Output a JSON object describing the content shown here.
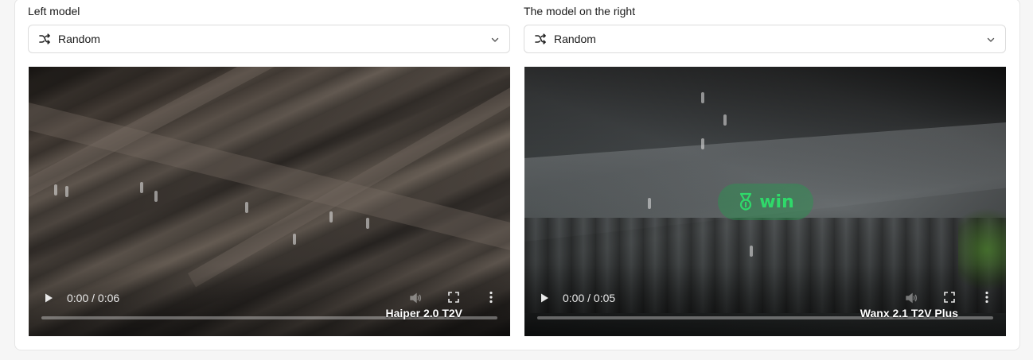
{
  "left_panel": {
    "label": "Left model",
    "select_value": "Random",
    "video": {
      "time": "0:00 / 0:06",
      "model_name": "Haiper 2.0 T2V"
    }
  },
  "right_panel": {
    "label": "The model on the right",
    "select_value": "Random",
    "video": {
      "time": "0:00 / 0:05",
      "model_name": "Wanx 2.1 T2V Plus",
      "badge": "win"
    }
  },
  "icons": {
    "select": "shuffle-icon",
    "dropdown": "chevron-down-icon",
    "play": "play-icon",
    "volume": "volume-icon",
    "fullscreen": "fullscreen-icon",
    "more": "more-vertical-icon",
    "winner": "medal-icon"
  },
  "colors": {
    "win_badge_text": "#2fd96a",
    "win_badge_bg": "#289650"
  }
}
